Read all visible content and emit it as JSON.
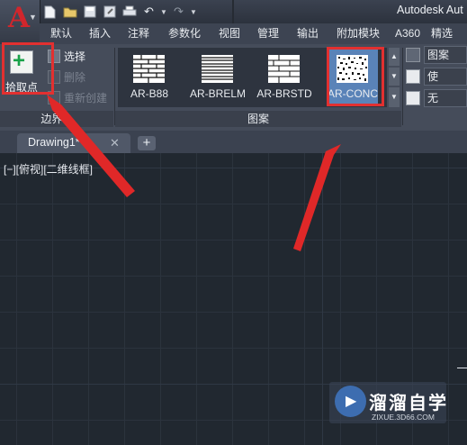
{
  "app": {
    "title": "Autodesk Aut",
    "logo_letter": "A"
  },
  "qat": {
    "icons": [
      "new-file-icon",
      "open-folder-icon",
      "save-icon",
      "save-as-icon",
      "print-icon",
      "undo-icon",
      "redo-icon"
    ]
  },
  "ribbon_tabs": [
    "默认",
    "插入",
    "注释",
    "参数化",
    "视图",
    "管理",
    "输出",
    "附加模块",
    "A360",
    "精选"
  ],
  "boundary_panel": {
    "pick_points_label": "拾取点",
    "select_label": "选择",
    "remove_label": "删除",
    "recreate_label": "重新创建",
    "title": "边界",
    "title_arrow": "▼"
  },
  "pattern_panel": {
    "title": "图案",
    "patterns": [
      "AR-B88",
      "AR-BRELM",
      "AR-BRSTD",
      "AR-CONC"
    ],
    "selected": "AR-CONC"
  },
  "properties_panel": {
    "type_value": "图案",
    "color_value": "使",
    "background_value": "无"
  },
  "file_tabs": {
    "active": "Drawing1*",
    "close_symbol": "✕",
    "add_symbol": "+"
  },
  "viewport": {
    "label": "[−][俯视][二维线框]"
  },
  "watermark": {
    "title": "溜溜自学",
    "url": "ZIXUE.3D66.COM"
  },
  "colors": {
    "accent_red": "#e23030",
    "canvas_bg": "#212830",
    "ribbon_bg": "#454c5a"
  }
}
